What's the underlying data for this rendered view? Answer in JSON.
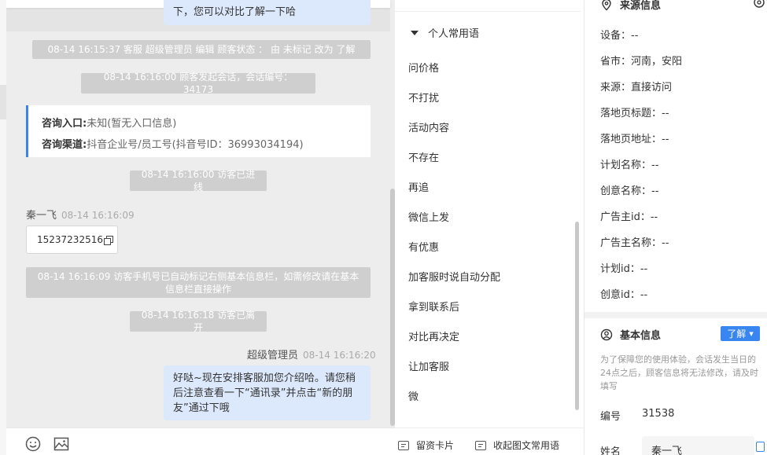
{
  "chat": {
    "top_bubble": "下，您可以对比了解一下哈",
    "sys1": "08-14 16:15:37 客服 超级管理员 编辑 顾客状态 ： 由 未标记 改为 了解",
    "sys2": "08-14 16:16:00 顾客发起会话，会话编号：34173",
    "entry_label": "咨询入口:",
    "entry_value": "未知(暂无入口信息)",
    "channel_label": "咨询渠道:",
    "channel_value": "抖音企业号/员工号(抖音号ID：36993034194)",
    "sys3": "08-14 16:16:00 访客已进线",
    "visitor_name": "秦一飞",
    "visitor_time": "08-14 16:16:09",
    "phone": "15237232516",
    "sys4": "08-14 16:16:09 访客手机号已自动标记右侧基本信息栏，如需修改请在基本信息栏直接操作",
    "sys5": "08-14 16:16:18 访客已离开",
    "agent_name": "超级管理员",
    "agent_time": "08-14 16:16:20",
    "agent_message": "好哒~现在安排客服加您介绍哈。请您稍后注意查看一下“通讯录”并点击“新的朋友”通过下哦"
  },
  "phrases": {
    "header": "个人常用语",
    "items": [
      "问价格",
      "不打扰",
      "活动内容",
      "不存在",
      "再追",
      "微信上发",
      "有优惠",
      "加客服时说自动分配",
      "拿到联系后",
      "对比再决定",
      "让加客服",
      "微"
    ],
    "btn_card": "留资卡片",
    "btn_collapse": "收起图文常用语"
  },
  "source": {
    "title": "来源信息",
    "fields": [
      "设备：--",
      "省市：河南，安阳",
      "来源：直接访问",
      "落地页标题：--",
      "落地页地址：--",
      "计划名称：--",
      "创意名称：--",
      "广告主id：--",
      "广告主名称：--",
      "计划id：--",
      "创意id：--"
    ]
  },
  "basic": {
    "title": "基本信息",
    "status_label": "了解",
    "note": "为了保障您的使用体验，会话发生当日的24点之后，顾客信息将无法修改，请及时填写",
    "id_label": "编号",
    "id_value": "31538",
    "name_label": "姓名",
    "name_value": "秦一飞"
  },
  "colors": {
    "accent": "#3a86f0",
    "bubble": "#dce8fb",
    "system_msg": "#cfcfcf"
  }
}
